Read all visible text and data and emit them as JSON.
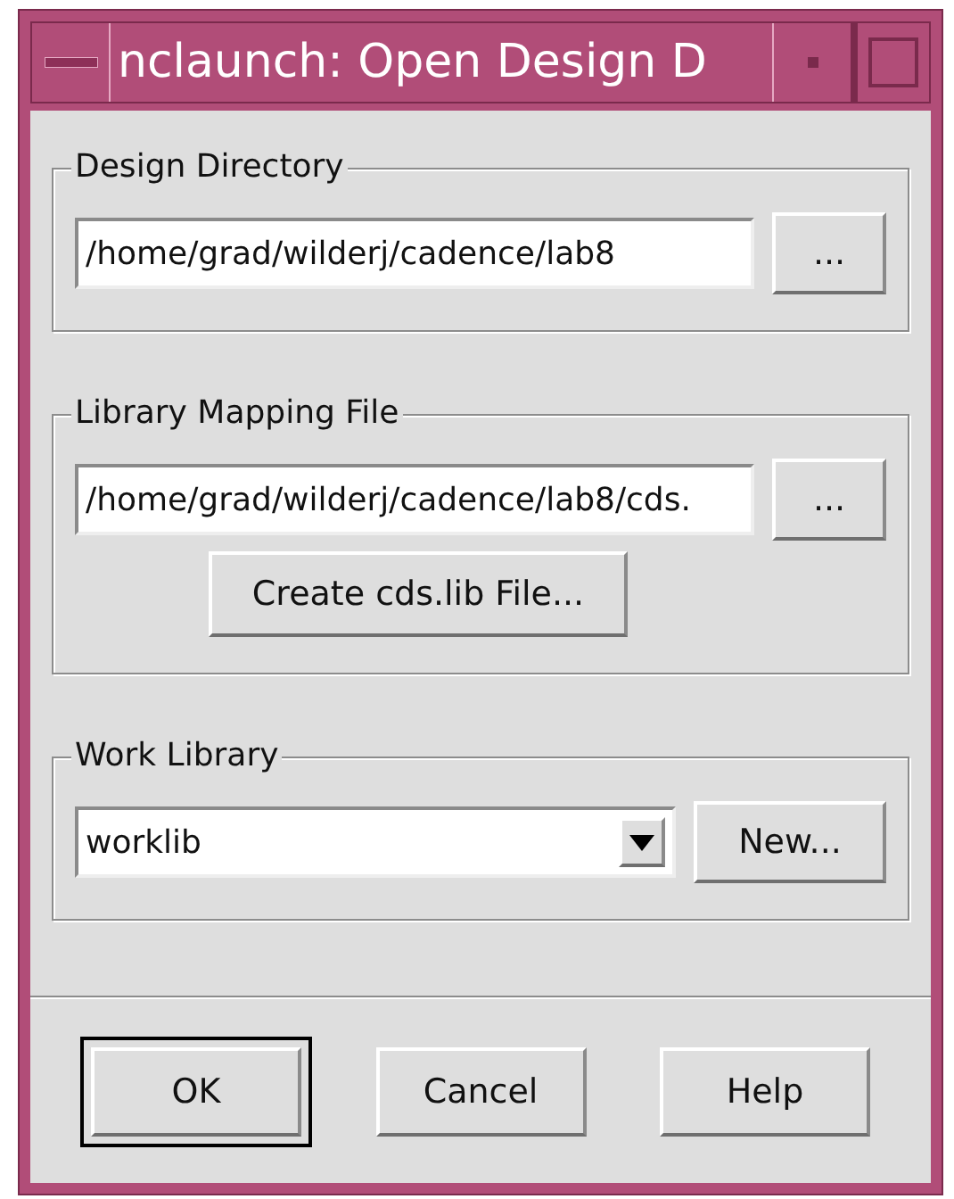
{
  "window": {
    "title": "nclaunch: Open Design D"
  },
  "groups": [
    {
      "kind": "path",
      "title": "Design Directory",
      "value": "/home/grad/wilderj/cadence/lab8",
      "browse": "..."
    },
    {
      "kind": "path",
      "title": "Library Mapping File",
      "value": "/home/grad/wilderj/cadence/lab8/cds.",
      "browse": "...",
      "action": "Create cds.lib File..."
    },
    {
      "kind": "combo",
      "title": "Work Library",
      "value": "worklib",
      "browse": "New..."
    }
  ],
  "buttons": [
    {
      "label": "OK",
      "default": true
    },
    {
      "label": "Cancel",
      "default": false
    },
    {
      "label": "Help",
      "default": false
    }
  ]
}
